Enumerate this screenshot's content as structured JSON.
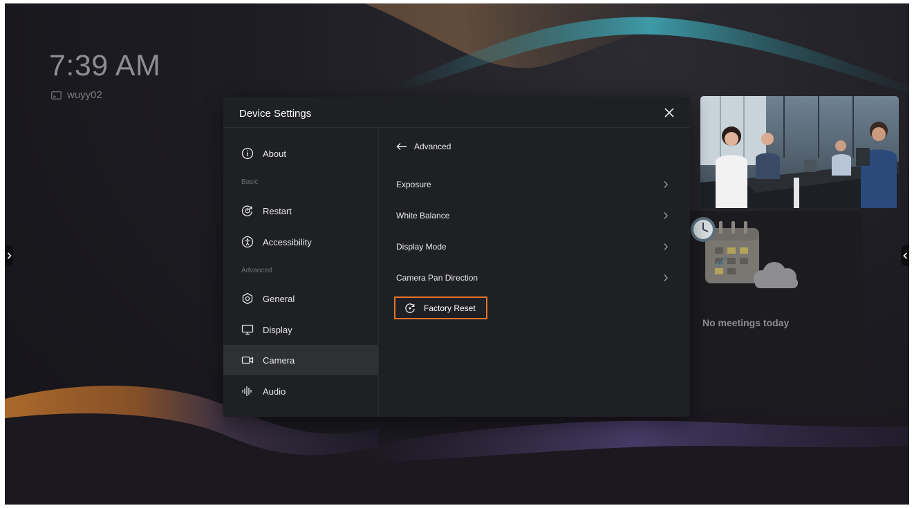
{
  "home": {
    "time": "7:39 AM",
    "device_name": "wuyy02",
    "no_meetings": "No meetings today"
  },
  "dialog": {
    "title": "Device Settings",
    "sidebar": {
      "about": "About",
      "section_basic": "Basic",
      "restart": "Restart",
      "accessibility": "Accessibility",
      "section_advanced": "Advanced",
      "general": "General",
      "display": "Display",
      "camera": "Camera",
      "audio": "Audio",
      "selected": "Camera"
    },
    "panel": {
      "back_label": "Advanced",
      "items": [
        "Exposure",
        "White Balance",
        "Display Mode",
        "Camera Pan Direction"
      ],
      "factory_reset": "Factory Reset"
    }
  },
  "colors": {
    "highlight_border": "#e8742a",
    "dialog_bg": "#1f2023",
    "selected_item_bg": "#2f3033"
  },
  "icons": [
    "cast-icon",
    "close-icon",
    "info-icon",
    "restart-icon",
    "accessibility-icon",
    "gear-icon",
    "monitor-icon",
    "camera-icon",
    "audio-icon",
    "back-arrow-icon",
    "chevron-right-icon",
    "factory-reset-icon",
    "chevron-left-icon",
    "chevron-right-edge-icon"
  ]
}
